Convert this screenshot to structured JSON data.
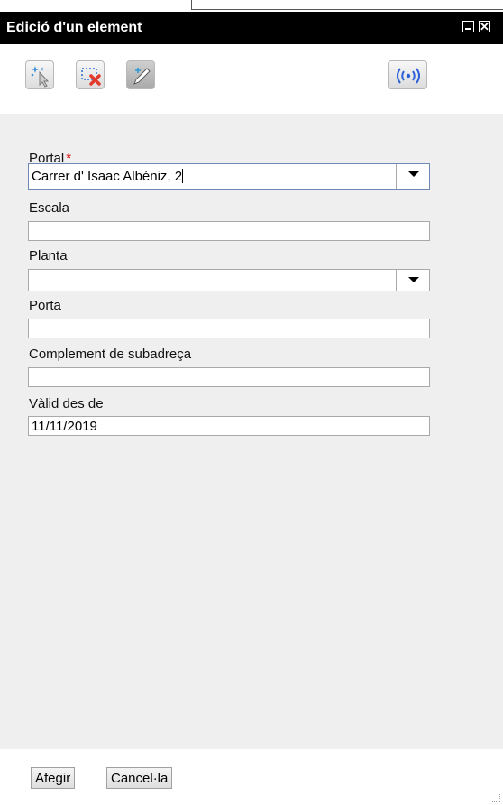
{
  "window": {
    "title": "Edició d'un element",
    "minimize_icon": "minimize-icon",
    "close_icon": "close-icon",
    "close_glyph": "✕"
  },
  "toolbar": {
    "buttons": [
      {
        "name": "select-add-point-button",
        "icon": "cursor-sparkle-icon"
      },
      {
        "name": "delete-selection-button",
        "icon": "selection-delete-icon"
      },
      {
        "name": "edit-pencil-button",
        "icon": "pencil-add-icon"
      },
      {
        "name": "signal-button",
        "icon": "broadcast-icon",
        "text": "((•))"
      }
    ]
  },
  "form": {
    "portal": {
      "label": "Portal",
      "required_mark": "*",
      "value": "Carrer d' Isaac Albéniz, 2"
    },
    "escala": {
      "label": "Escala",
      "value": ""
    },
    "planta": {
      "label": "Planta",
      "value": ""
    },
    "porta": {
      "label": "Porta",
      "value": ""
    },
    "complement": {
      "label": "Complement de subadreça",
      "value": ""
    },
    "valid_from": {
      "label": "Vàlid des de",
      "value": "11/11/2019"
    }
  },
  "footer": {
    "add_label": "Afegir",
    "cancel_label": "Cancel·la"
  },
  "colors": {
    "titlebar": "#000000",
    "panel": "#efefef",
    "required": "#e00000",
    "signal_icon": "#2b5fd9"
  }
}
